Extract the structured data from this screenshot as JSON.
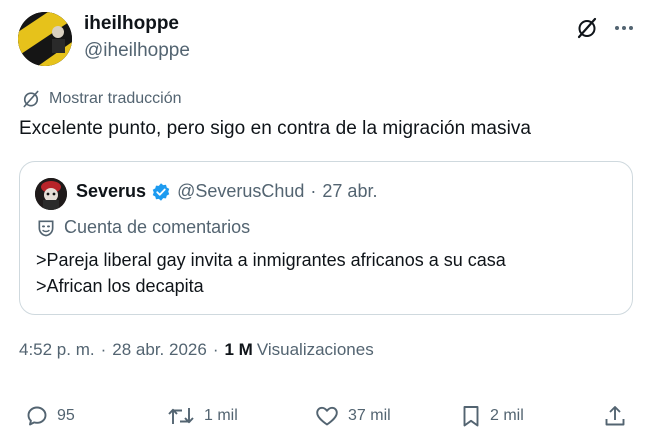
{
  "author": {
    "display_name": "iheilhoppe",
    "handle": "@iheilhoppe"
  },
  "translate": {
    "label": "Mostrar traducción"
  },
  "tweet": {
    "text": "Excelente punto, pero sigo en contra de la migración masiva"
  },
  "quote": {
    "display_name": "Severus",
    "handle": "@SeverusChud",
    "separator": "·",
    "date": "27 abr.",
    "label": "Cuenta de comentarios",
    "lines": [
      ">Pareja liberal gay invita a inmigrantes africanos a su casa",
      ">African los decapita"
    ]
  },
  "meta": {
    "time": "4:52 p. m.",
    "separator": "·",
    "date": "28 abr. 2026",
    "views_count": "1 M",
    "views_label": "Visualizaciones"
  },
  "actions": {
    "replies": "95",
    "reposts": "1 mil",
    "likes": "37 mil",
    "bookmarks": "2 mil"
  },
  "colors": {
    "text_primary": "#0f1419",
    "text_secondary": "#536471",
    "border": "#cfd9de",
    "verified": "#1d9bf0",
    "avatar_yellow": "#e6c21b"
  }
}
